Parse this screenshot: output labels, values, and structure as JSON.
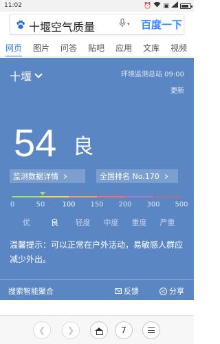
{
  "status_bar": {
    "time": "11:02",
    "battery_level": 0.85
  },
  "search": {
    "query": "十堰空气质量",
    "button": "百度一下",
    "mic_caret": "▾"
  },
  "tabs": [
    {
      "label": "网页",
      "active": true
    },
    {
      "label": "图片",
      "active": false
    },
    {
      "label": "问答",
      "active": false
    },
    {
      "label": "贴吧",
      "active": false
    },
    {
      "label": "应用",
      "active": false
    },
    {
      "label": "文库",
      "active": false
    },
    {
      "label": "视频",
      "active": false
    }
  ],
  "card": {
    "city": "十堰",
    "station": "环境监测总站 09:00",
    "update": "更新",
    "aqi": "54",
    "level": "良",
    "detail_link": "监测数据详情",
    "rank_link": "全国排名 No.170",
    "scale_ticks": [
      "0",
      "50",
      "100",
      "150",
      "200",
      "300",
      "500"
    ],
    "active_tick": 2,
    "levels": [
      "优",
      "良",
      "轻度",
      "中度",
      "重度",
      "严重"
    ],
    "active_level": 1,
    "segment_colors": [
      "#a8e05f",
      "#fdd64b",
      "#ff9b57",
      "#fe6a69",
      "#a97abc",
      "#a87383"
    ],
    "tip": "温馨提示：可以正常在户外活动，易敏感人群应减少外出。",
    "footer": {
      "aggregate": "搜索智能聚合",
      "feedback": "反馈",
      "share": "分享"
    }
  },
  "bottom_bar": {
    "back": "❮",
    "forward": "❯",
    "tab_count": "7"
  }
}
